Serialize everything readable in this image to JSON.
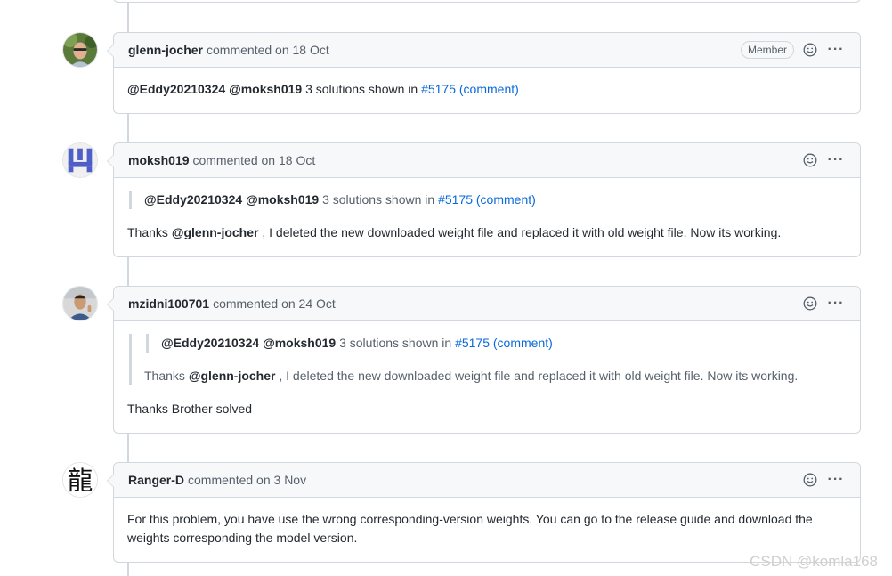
{
  "comments": [
    {
      "author": "glenn-jocher",
      "meta": "commented on 18 Oct",
      "badge": "Member",
      "avatar_icon": "user-photo-icon",
      "body": {
        "mention1": "@Eddy20210324",
        "mention2": "@moksh019",
        "text": " 3 solutions shown in ",
        "link1": "#5175",
        "link2": "(comment)"
      }
    },
    {
      "author": "moksh019",
      "meta": "commented on 18 Oct",
      "avatar_icon": "identicon-icon",
      "quote": {
        "mention1": "@Eddy20210324",
        "mention2": "@moksh019",
        "text": " 3 solutions shown in ",
        "link1": "#5175",
        "link2": "(comment)"
      },
      "reply": {
        "pre": "Thanks ",
        "mention": "@glenn-jocher",
        "post": " , I deleted the new downloaded weight file and replaced it with old weight file. Now its working."
      }
    },
    {
      "author": "mzidni100701",
      "meta": "commented on 24 Oct",
      "avatar_icon": "user-photo-icon",
      "quote": {
        "mention1": "@Eddy20210324",
        "mention2": "@moksh019",
        "text": " 3 solutions shown in ",
        "link1": "#5175",
        "link2": "(comment)"
      },
      "quote_reply": {
        "pre": "Thanks ",
        "mention": "@glenn-jocher",
        "post": " , I deleted the new downloaded weight file and replaced it with old weight file. Now its working."
      },
      "reply": "Thanks Brother solved"
    },
    {
      "author": "Ranger-D",
      "meta": "commented on 3 Nov",
      "avatar_icon": "dragon-character-icon",
      "avatar_glyph": "龍",
      "body": "For this problem, you have use the wrong corresponding-version weights. You can go to the release guide and download the weights corresponding the model version."
    }
  ],
  "actions": {
    "reaction_icon": "smiley-icon",
    "menu_icon": "kebab-menu-icon",
    "menu_glyph": "···"
  },
  "watermark": "CSDN @komla168",
  "colors": {
    "link": "#0969da",
    "border": "#d0d7de",
    "header_bg": "#f6f8fa",
    "identicon": "#4f5fc7"
  }
}
